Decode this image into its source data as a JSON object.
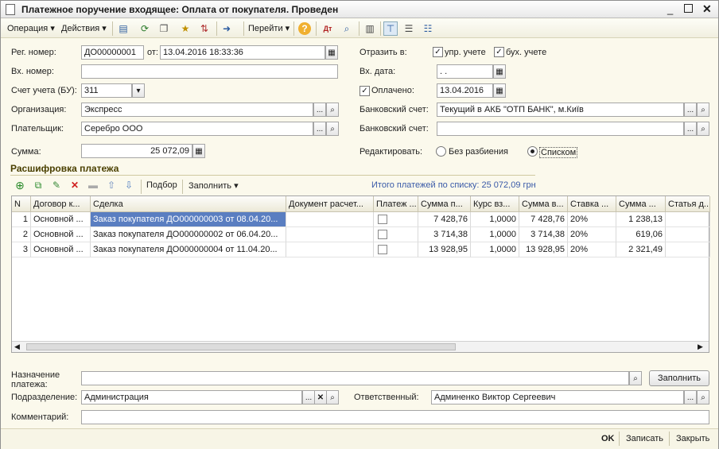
{
  "window": {
    "title": "Платежное поручение входящее: Оплата от покупателя. Проведен"
  },
  "toolbar": {
    "operation": "Операция",
    "actions": "Действия",
    "goto": "Перейти"
  },
  "form": {
    "reg_label": "Рег. номер:",
    "reg_value": "ДО00000001",
    "from_label": "от:",
    "date_value": "13.04.2016 18:33:36",
    "in_num_label": "Вх. номер:",
    "in_num_value": "",
    "account_label": "Счет учета (БУ):",
    "account_value": "311",
    "org_label": "Организация:",
    "org_value": "Экспресс",
    "payer_label": "Плательщик:",
    "payer_value": "Серебро ООО",
    "sum_label": "Сумма:",
    "sum_value": "25 072,09",
    "reflect_label": "Отразить в:",
    "mgmt_label": "упр. учете",
    "acc_label": "бух. учете",
    "in_date_label": "Вх. дата:",
    "in_date_value": " .  .",
    "paid_label": "Оплачено:",
    "paid_value": "13.04.2016",
    "bank1_label": "Банковский счет:",
    "bank1_value": "Текущий в АКБ \"ОТП БАНК\", м.Київ",
    "bank2_label": "Банковский счет:",
    "bank2_value": "",
    "edit_label": "Редактировать:",
    "opt1": "Без разбиения",
    "opt2": "Списком"
  },
  "section": {
    "title": "Расшифровка платежа",
    "pick": "Подбор",
    "fill": "Заполнить",
    "total": "Итого платежей по списку: 25 072,09 грн"
  },
  "table": {
    "headers": [
      "N",
      "Договор к...",
      "Сделка",
      "Документ расчет...",
      "Платеж ...",
      "Сумма п...",
      "Курс вз...",
      "Сумма в...",
      "Ставка ...",
      "Сумма ...",
      "Статья д..."
    ],
    "rows": [
      [
        "1",
        "Основной ...",
        "Заказ покупателя ДО000000003 от 08.04.20...",
        "",
        "",
        "7 428,76",
        "1,0000",
        "7 428,76",
        "20%",
        "1 238,13",
        ""
      ],
      [
        "2",
        "Основной ...",
        "Заказ покупателя ДО000000002 от 06.04.20...",
        "",
        "",
        "3 714,38",
        "1,0000",
        "3 714,38",
        "20%",
        "619,06",
        ""
      ],
      [
        "3",
        "Основной ...",
        "Заказ покупателя ДО000000004 от 11.04.20...",
        "",
        "",
        "13 928,95",
        "1,0000",
        "13 928,95",
        "20%",
        "2 321,49",
        ""
      ]
    ]
  },
  "bottom": {
    "purpose_label": "Назначение платежа:",
    "purpose_value": "",
    "fill_btn": "Заполнить",
    "dept_label": "Подразделение:",
    "dept_value": "Администрация",
    "resp_label": "Ответственный:",
    "resp_value": "Админенко Виктор Сергеевич",
    "comment_label": "Комментарий:",
    "comment_value": ""
  },
  "footer": {
    "ok": "OK",
    "save": "Записать",
    "close": "Закрыть"
  }
}
